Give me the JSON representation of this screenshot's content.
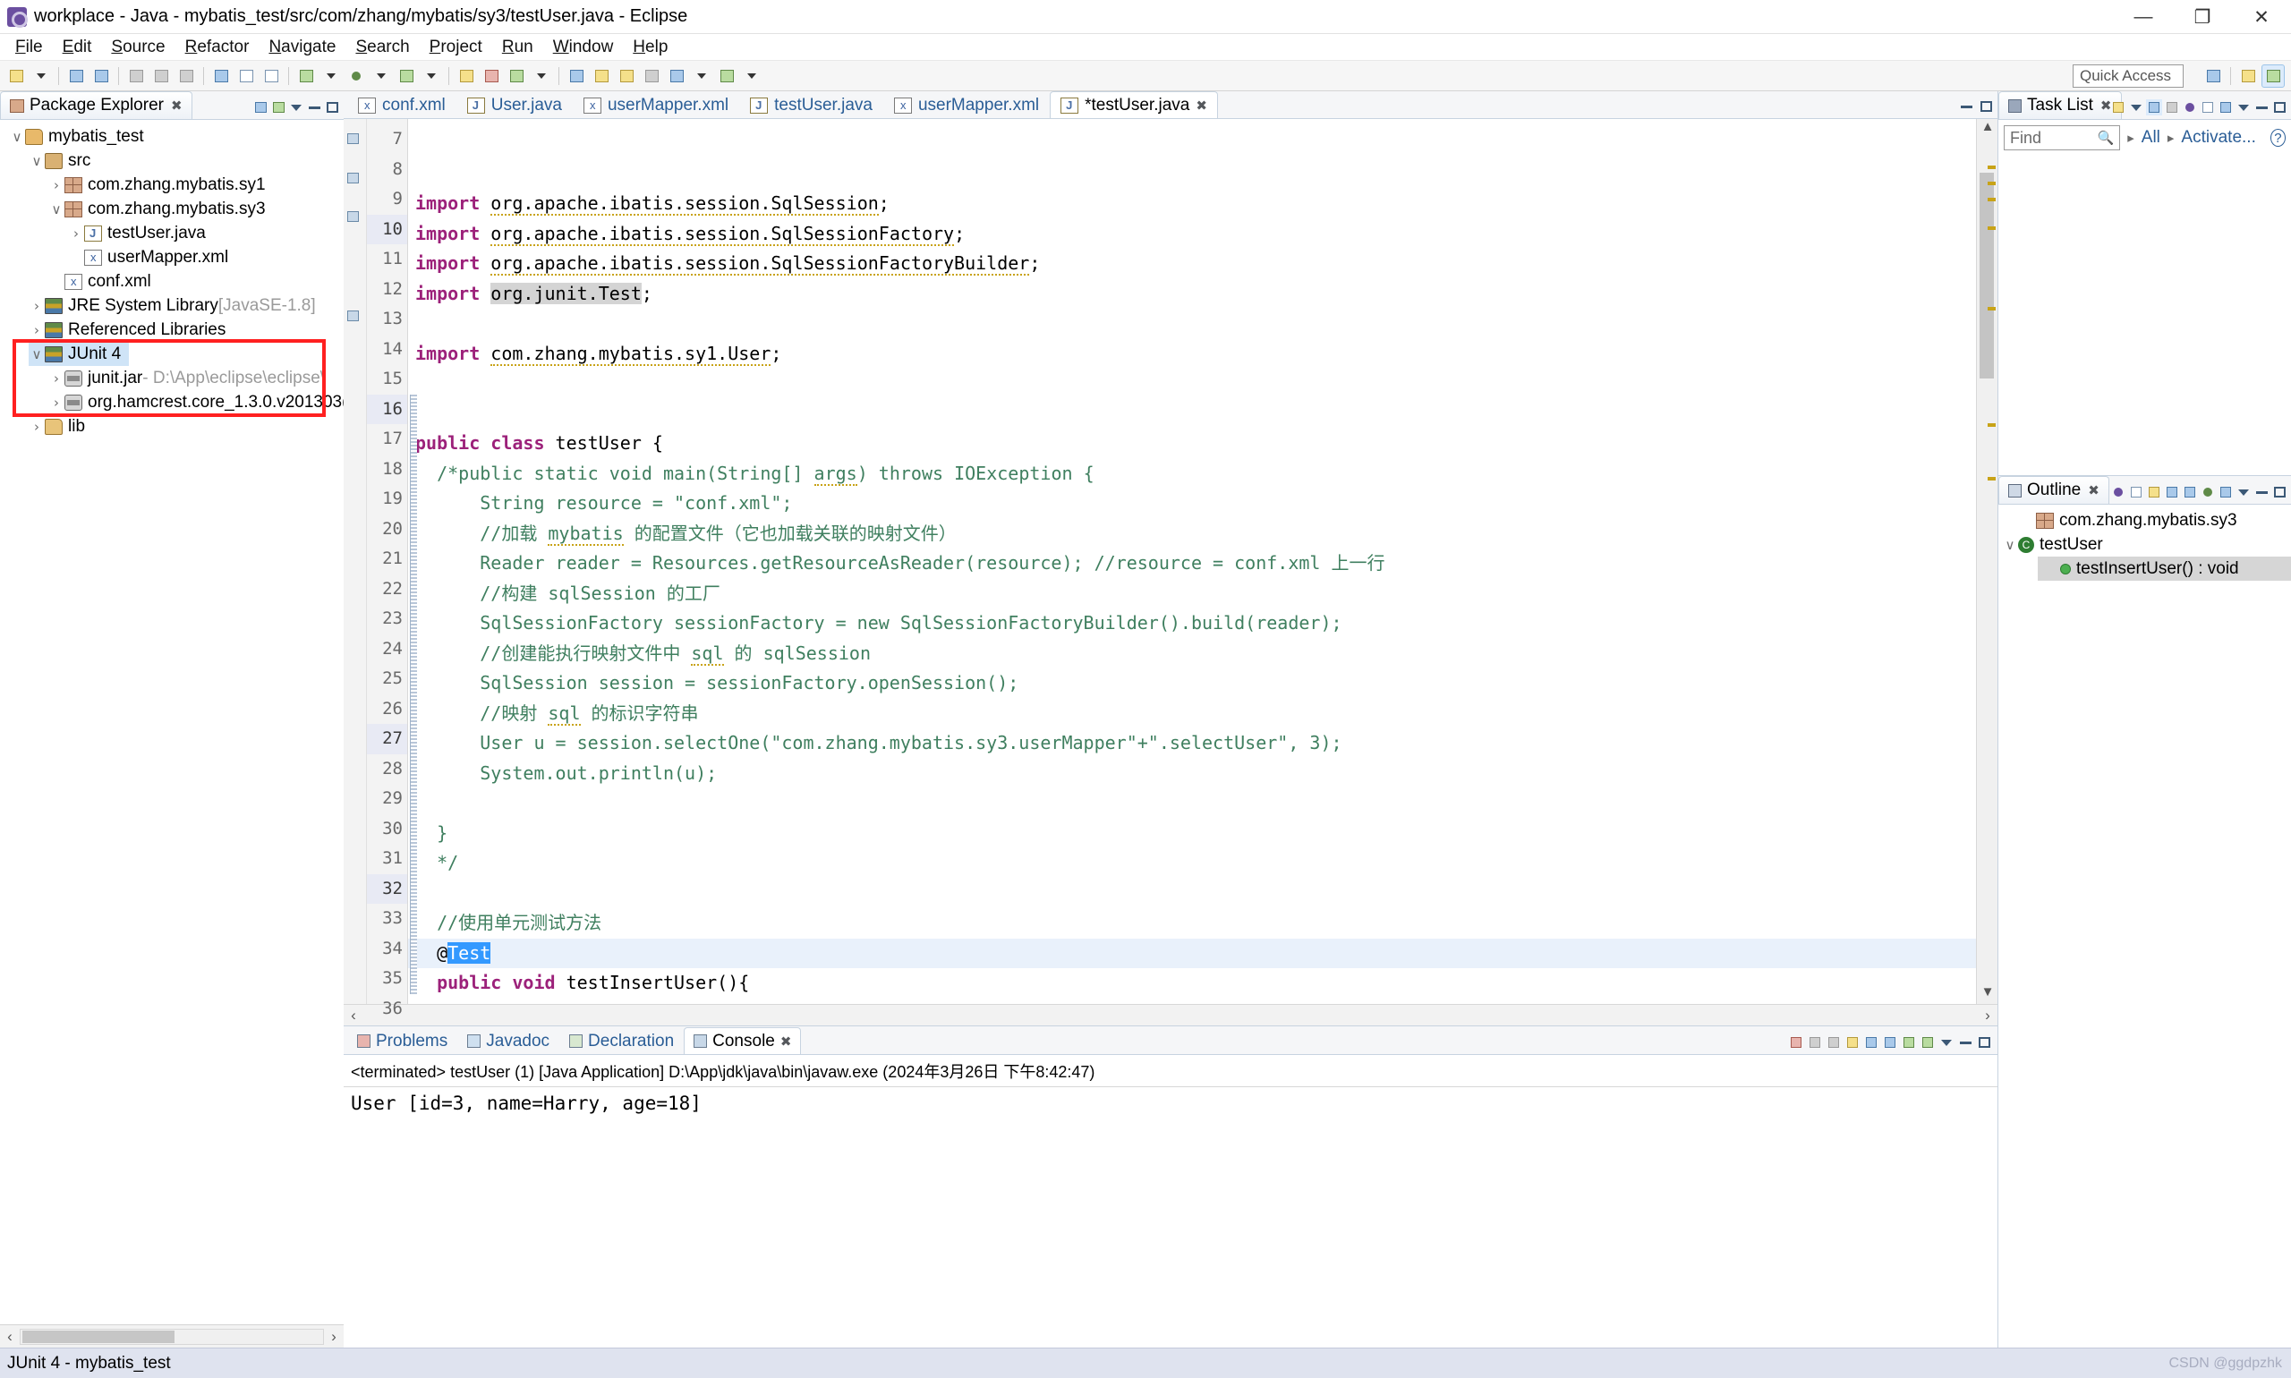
{
  "window": {
    "title": "workplace - Java - mybatis_test/src/com/zhang/mybatis/sy3/testUser.java - Eclipse",
    "minimize": "—",
    "maximize": "❐",
    "close": "✕"
  },
  "menu": [
    "File",
    "Edit",
    "Source",
    "Refactor",
    "Navigate",
    "Search",
    "Project",
    "Run",
    "Window",
    "Help"
  ],
  "toolbar": {
    "quick_access": "Quick Access"
  },
  "package_explorer": {
    "tab_label": "Package Explorer",
    "close_glyph": "✖",
    "items": [
      {
        "label": "mybatis_test",
        "sub": "",
        "indent": 0,
        "arrow": "v",
        "icon": "project-icon",
        "selected": false
      },
      {
        "label": "src",
        "sub": "",
        "indent": 1,
        "arrow": "v",
        "icon": "source-folder-icon",
        "selected": false
      },
      {
        "label": "com.zhang.mybatis.sy1",
        "sub": "",
        "indent": 2,
        "arrow": ">",
        "icon": "package-icon",
        "selected": false
      },
      {
        "label": "com.zhang.mybatis.sy3",
        "sub": "",
        "indent": 2,
        "arrow": "v",
        "icon": "package-icon",
        "selected": false
      },
      {
        "label": "testUser.java",
        "sub": "",
        "indent": 3,
        "arrow": ">",
        "icon": "java-file-icon",
        "selected": false
      },
      {
        "label": "userMapper.xml",
        "sub": "",
        "indent": 3,
        "arrow": "",
        "icon": "xml-file-icon",
        "selected": false
      },
      {
        "label": "conf.xml",
        "sub": "",
        "indent": 2,
        "arrow": "",
        "icon": "xml-file-icon",
        "selected": false
      },
      {
        "label": "JRE System Library",
        "sub": "[JavaSE-1.8]",
        "indent": 1,
        "arrow": ">",
        "icon": "library-icon",
        "selected": false
      },
      {
        "label": "Referenced Libraries",
        "sub": "",
        "indent": 1,
        "arrow": ">",
        "icon": "library-icon",
        "selected": false
      },
      {
        "label": "JUnit 4",
        "sub": "",
        "indent": 1,
        "arrow": "v",
        "icon": "library-icon",
        "selected": true
      },
      {
        "label": "junit.jar",
        "sub": "- D:\\App\\eclipse\\eclipse\\",
        "indent": 2,
        "arrow": ">",
        "icon": "jar-icon",
        "selected": false
      },
      {
        "label": "org.hamcrest.core_1.3.0.v201303(",
        "sub": "",
        "indent": 2,
        "arrow": ">",
        "icon": "jar-icon",
        "selected": false
      },
      {
        "label": "lib",
        "sub": "",
        "indent": 1,
        "arrow": ">",
        "icon": "folder-icon",
        "selected": false
      }
    ],
    "scroll_left": "‹",
    "scroll_right": "›"
  },
  "editor": {
    "tabs": [
      {
        "label": "conf.xml",
        "icon": "xml-file-icon",
        "active": false,
        "closable": false
      },
      {
        "label": "User.java",
        "icon": "java-file-icon",
        "active": false,
        "closable": false
      },
      {
        "label": "userMapper.xml",
        "icon": "xml-file-icon",
        "active": false,
        "closable": false
      },
      {
        "label": "testUser.java",
        "icon": "java-file-icon",
        "active": false,
        "closable": false
      },
      {
        "label": "userMapper.xml",
        "icon": "xml-file-icon",
        "active": false,
        "closable": false
      },
      {
        "label": "*testUser.java",
        "icon": "java-file-icon",
        "active": true,
        "closable": true
      }
    ],
    "close_glyph": "✖",
    "lines": [
      {
        "n": "7",
        "marker": "import",
        "current": false,
        "fold": false,
        "parts": [
          {
            "t": "import ",
            "c": "kw"
          },
          {
            "t": "org.apache.ibatis.session.SqlSession",
            "c": "wav"
          },
          {
            "t": ";",
            "c": ""
          }
        ]
      },
      {
        "n": "8",
        "marker": "import",
        "current": false,
        "fold": false,
        "parts": [
          {
            "t": "import ",
            "c": "kw"
          },
          {
            "t": "org.apache.ibatis.session.SqlSessionFactory",
            "c": "wav"
          },
          {
            "t": ";",
            "c": ""
          }
        ]
      },
      {
        "n": "9",
        "marker": "import",
        "current": false,
        "fold": false,
        "parts": [
          {
            "t": "import ",
            "c": "kw"
          },
          {
            "t": "org.apache.ibatis.session.SqlSessionFactoryBuilder",
            "c": "wav"
          },
          {
            "t": ";",
            "c": ""
          }
        ]
      },
      {
        "n": "10",
        "marker": "",
        "current": false,
        "fold": false,
        "gutterhl": true,
        "parts": [
          {
            "t": "import ",
            "c": "kw"
          },
          {
            "t": "org.junit.Test",
            "c": "occ"
          },
          {
            "t": ";",
            "c": ""
          }
        ]
      },
      {
        "n": "11",
        "marker": "",
        "current": false,
        "fold": false,
        "parts": []
      },
      {
        "n": "12",
        "marker": "import",
        "current": false,
        "fold": false,
        "parts": [
          {
            "t": "import ",
            "c": "kw"
          },
          {
            "t": "com.zhang.mybatis.sy1.User",
            "c": "wav"
          },
          {
            "t": ";",
            "c": ""
          }
        ]
      },
      {
        "n": "13",
        "marker": "",
        "current": false,
        "fold": false,
        "parts": []
      },
      {
        "n": "14",
        "marker": "",
        "current": false,
        "fold": false,
        "parts": []
      },
      {
        "n": "15",
        "marker": "",
        "current": false,
        "fold": false,
        "parts": [
          {
            "t": "public class ",
            "c": "kw"
          },
          {
            "t": "testUser {",
            "c": ""
          }
        ]
      },
      {
        "n": "16",
        "marker": "",
        "current": false,
        "fold": true,
        "gutterhl": true,
        "parts": [
          {
            "t": "  /*public static void main(String[] ",
            "c": "cmt"
          },
          {
            "t": "args",
            "c": "cmt wav"
          },
          {
            "t": ") throws IOException {",
            "c": "cmt"
          }
        ]
      },
      {
        "n": "17",
        "marker": "",
        "current": false,
        "fold": true,
        "parts": [
          {
            "t": "      String resource = \"conf.xml\";",
            "c": "cmt"
          }
        ]
      },
      {
        "n": "18",
        "marker": "",
        "current": false,
        "fold": true,
        "parts": [
          {
            "t": "      //加载 ",
            "c": "cmt"
          },
          {
            "t": "mybatis",
            "c": "cmt wav"
          },
          {
            "t": " 的配置文件（它也加载关联的映射文件）",
            "c": "cmt"
          }
        ]
      },
      {
        "n": "19",
        "marker": "",
        "current": false,
        "fold": true,
        "parts": [
          {
            "t": "      Reader reader = Resources.getResourceAsReader(resource); //resource = conf.xml 上一行",
            "c": "cmt"
          }
        ]
      },
      {
        "n": "20",
        "marker": "",
        "current": false,
        "fold": true,
        "parts": [
          {
            "t": "      //构建 sqlSession 的工厂",
            "c": "cmt"
          }
        ]
      },
      {
        "n": "21",
        "marker": "",
        "current": false,
        "fold": true,
        "parts": [
          {
            "t": "      SqlSessionFactory sessionFactory = new SqlSessionFactoryBuilder().build(reader);",
            "c": "cmt"
          }
        ]
      },
      {
        "n": "22",
        "marker": "",
        "current": false,
        "fold": true,
        "parts": [
          {
            "t": "      //创建能执行映射文件中 ",
            "c": "cmt"
          },
          {
            "t": "sql",
            "c": "cmt wav"
          },
          {
            "t": " 的 sqlSession",
            "c": "cmt"
          }
        ]
      },
      {
        "n": "23",
        "marker": "",
        "current": false,
        "fold": true,
        "parts": [
          {
            "t": "      SqlSession session = sessionFactory.openSession();",
            "c": "cmt"
          }
        ]
      },
      {
        "n": "24",
        "marker": "",
        "current": false,
        "fold": true,
        "parts": [
          {
            "t": "      //映射 ",
            "c": "cmt"
          },
          {
            "t": "sql",
            "c": "cmt wav"
          },
          {
            "t": " 的标识字符串",
            "c": "cmt"
          }
        ]
      },
      {
        "n": "25",
        "marker": "",
        "current": false,
        "fold": true,
        "parts": [
          {
            "t": "      User u = session.selectOne(\"com.zhang.mybatis.sy3.userMapper\"+\".selectUser\", 3);",
            "c": "cmt"
          }
        ]
      },
      {
        "n": "26",
        "marker": "",
        "current": false,
        "fold": true,
        "parts": [
          {
            "t": "      System.out.println(u);",
            "c": "cmt"
          }
        ]
      },
      {
        "n": "27",
        "marker": "",
        "current": false,
        "fold": true,
        "gutterhl": true,
        "parts": []
      },
      {
        "n": "28",
        "marker": "",
        "current": false,
        "fold": true,
        "parts": [
          {
            "t": "  }",
            "c": "cmt"
          }
        ]
      },
      {
        "n": "29",
        "marker": "",
        "current": false,
        "fold": true,
        "parts": [
          {
            "t": "  */",
            "c": "cmt"
          }
        ]
      },
      {
        "n": "30",
        "marker": "",
        "current": false,
        "fold": true,
        "parts": []
      },
      {
        "n": "31",
        "marker": "",
        "current": false,
        "fold": true,
        "parts": [
          {
            "t": "  //使用单元测试方法",
            "c": "cmt"
          }
        ]
      },
      {
        "n": "32",
        "marker": "",
        "current": true,
        "fold": true,
        "parts": [
          {
            "t": "  @",
            "c": ""
          },
          {
            "t": "Test",
            "c": "selt"
          }
        ]
      },
      {
        "n": "33",
        "marker": "",
        "current": false,
        "fold": true,
        "parts": [
          {
            "t": "  public void ",
            "c": "kw"
          },
          {
            "t": "testInsertUser(){",
            "c": ""
          }
        ]
      },
      {
        "n": "34",
        "marker": "",
        "current": false,
        "fold": true,
        "parts": []
      },
      {
        "n": "35",
        "marker": "",
        "current": false,
        "fold": true,
        "parts": [
          {
            "t": "  }",
            "c": ""
          }
        ]
      },
      {
        "n": "36",
        "marker": "",
        "current": false,
        "fold": false,
        "parts": [
          {
            "t": "}",
            "c": ""
          }
        ]
      }
    ]
  },
  "console": {
    "tabs": [
      {
        "label": "Problems",
        "icon": "problems-icon",
        "active": false
      },
      {
        "label": "Javadoc",
        "icon": "javadoc-icon",
        "active": false
      },
      {
        "label": "Declaration",
        "icon": "declaration-icon",
        "active": false
      },
      {
        "label": "Console",
        "icon": "console-icon",
        "active": true
      }
    ],
    "close_glyph": "✖",
    "process_line": "<terminated> testUser (1) [Java Application] D:\\App\\jdk\\java\\bin\\javaw.exe (2024年3月26日 下午8:42:47)",
    "output": "User [id=3, name=Harry, age=18]"
  },
  "task_list": {
    "tab_label": "Task List",
    "close_glyph": "✖",
    "find_placeholder": "Find",
    "link_all": "All",
    "link_activate": "Activate...",
    "help_glyph": "?"
  },
  "outline": {
    "tab_label": "Outline",
    "close_glyph": "✖",
    "items": [
      {
        "label": "com.zhang.mybatis.sy3",
        "icon": "package-icon",
        "arrow": "",
        "indent": 1,
        "highlight": false
      },
      {
        "label": "testUser",
        "icon": "class-icon",
        "arrow": "v",
        "indent": 0,
        "highlight": false
      },
      {
        "label": "testInsertUser() : void",
        "icon": "method-icon",
        "arrow": "",
        "indent": 2,
        "highlight": true
      }
    ]
  },
  "status_bar": {
    "text": "JUnit 4 - mybatis_test",
    "watermark": "CSDN @ggdpzhk"
  }
}
